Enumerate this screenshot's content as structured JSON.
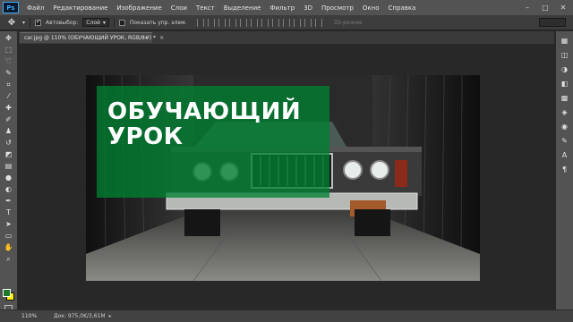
{
  "app": {
    "logo": "Ps"
  },
  "menu": [
    "Файл",
    "Редактирование",
    "Изображение",
    "Слои",
    "Текст",
    "Выделение",
    "Фильтр",
    "3D",
    "Просмотр",
    "Окно",
    "Справка"
  ],
  "options": {
    "autoselect_label": "Автовыбор:",
    "autoselect_value": "Слой",
    "show_controls_label": "Показать упр. элем.",
    "mode3d_label": "3D-режим"
  },
  "document": {
    "tab_title": "car.jpg @ 110% (ОБУЧАЮЩИЙ УРОК, RGB/8#) *",
    "close": "×"
  },
  "overlay_text": {
    "line1": "ОБУЧАЮЩИЙ",
    "line2": "УРОК"
  },
  "status": {
    "zoom": "110%",
    "doc_info": "Док: 975,0K/3,61M"
  },
  "colors": {
    "foreground": "#1a7a2a",
    "background": "#ffee00",
    "overlay": "#008032"
  },
  "tools_left": [
    "move-icon",
    "marquee-icon",
    "lasso-icon",
    "quick-select-icon",
    "crop-icon",
    "eyedropper-icon",
    "healing-brush-icon",
    "brush-icon",
    "clone-stamp-icon",
    "history-brush-icon",
    "eraser-icon",
    "gradient-icon",
    "blur-icon",
    "dodge-icon",
    "pen-icon",
    "type-icon",
    "path-select-icon",
    "rectangle-icon",
    "hand-icon",
    "zoom-icon"
  ],
  "tools_right": [
    "history-icon",
    "properties-icon",
    "adjustments-icon",
    "styles-icon",
    "swatches-icon",
    "layers-icon",
    "channels-icon",
    "paths-icon",
    "character-icon",
    "paragraph-icon"
  ]
}
